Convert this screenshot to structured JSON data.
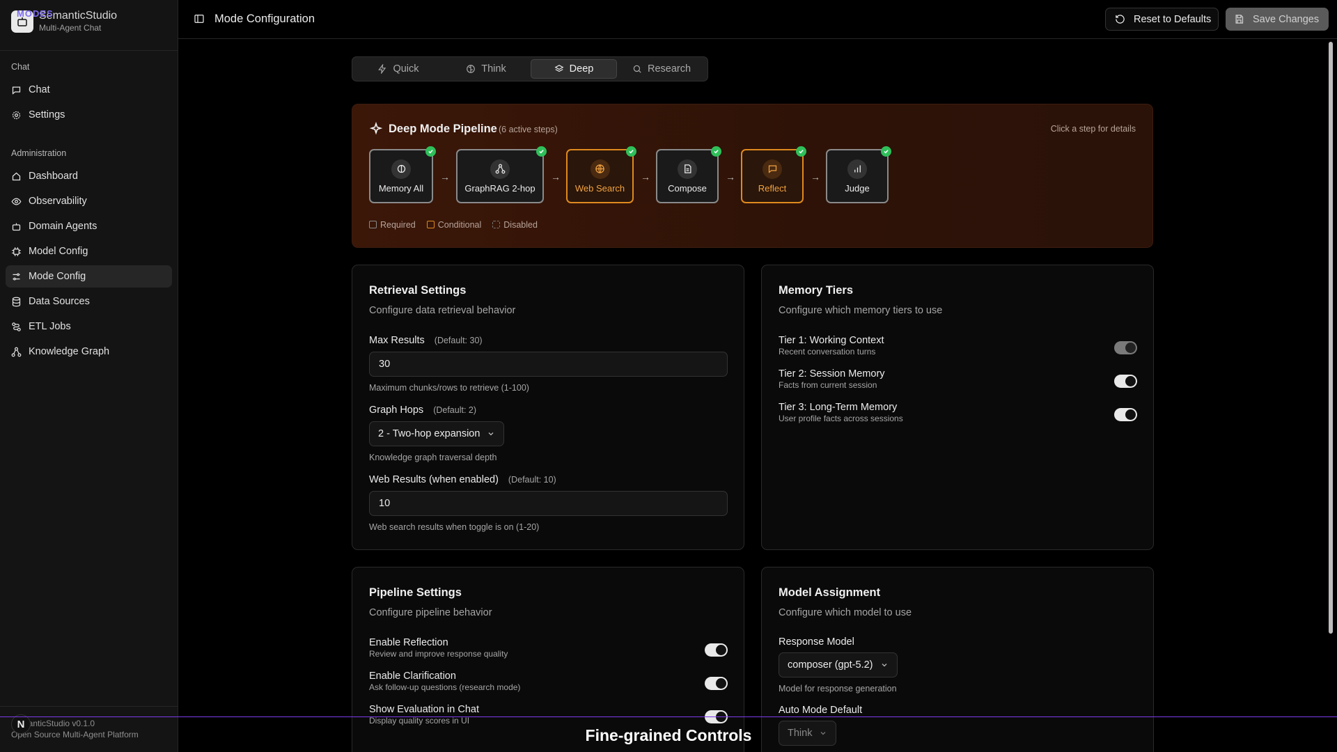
{
  "brand": {
    "tag": "MODES",
    "title": "SemanticStudio",
    "subtitle": "Multi-Agent Chat"
  },
  "sidebar": {
    "groups": [
      {
        "label": "Chat",
        "items": [
          {
            "label": "Chat",
            "icon": "chat-icon"
          },
          {
            "label": "Settings",
            "icon": "gear-icon"
          }
        ]
      },
      {
        "label": "Administration",
        "items": [
          {
            "label": "Dashboard",
            "icon": "home-icon"
          },
          {
            "label": "Observability",
            "icon": "eye-icon"
          },
          {
            "label": "Domain Agents",
            "icon": "bot-icon"
          },
          {
            "label": "Model Config",
            "icon": "chip-icon"
          },
          {
            "label": "Mode Config",
            "icon": "sliders-icon",
            "active": true
          },
          {
            "label": "Data Sources",
            "icon": "database-icon"
          },
          {
            "label": "ETL Jobs",
            "icon": "workflow-icon"
          },
          {
            "label": "Knowledge Graph",
            "icon": "graph-icon"
          }
        ]
      }
    ],
    "footer": {
      "version": "SemanticStudio v0.1.0",
      "platform": "Open Source Multi-Agent Platform",
      "badge": "N"
    }
  },
  "header": {
    "title": "Mode Configuration",
    "reset_label": "Reset to Defaults",
    "save_label": "Save Changes"
  },
  "tabs": [
    {
      "label": "Quick",
      "icon": "zap-icon"
    },
    {
      "label": "Think",
      "icon": "brain-icon"
    },
    {
      "label": "Deep",
      "icon": "layers-icon",
      "active": true
    },
    {
      "label": "Research",
      "icon": "search-icon"
    }
  ],
  "pipeline": {
    "title": "Deep Mode Pipeline",
    "count": "(6 active steps)",
    "hint": "Click a step for details",
    "steps": [
      {
        "label": "Memory All",
        "kind": "required",
        "icon": "brain-icon"
      },
      {
        "label": "GraphRAG 2-hop",
        "kind": "required",
        "icon": "network-icon"
      },
      {
        "label": "Web Search",
        "kind": "conditional",
        "icon": "globe-icon"
      },
      {
        "label": "Compose",
        "kind": "required",
        "icon": "document-icon"
      },
      {
        "label": "Reflect",
        "kind": "conditional",
        "icon": "message-icon"
      },
      {
        "label": "Judge",
        "kind": "required",
        "icon": "bar-chart-icon"
      }
    ],
    "legend": {
      "required": "Required",
      "conditional": "Conditional",
      "disabled": "Disabled"
    },
    "colors": {
      "required": "#8a8a8a",
      "conditional": "#e08a1e",
      "check": "#2fbf5a"
    }
  },
  "retrieval": {
    "title": "Retrieval Settings",
    "desc": "Configure data retrieval behavior",
    "max_results": {
      "label": "Max Results",
      "default": "(Default: 30)",
      "value": "30",
      "help": "Maximum chunks/rows to retrieve (1-100)"
    },
    "graph_hops": {
      "label": "Graph Hops",
      "default": "(Default: 2)",
      "value": "2 - Two-hop expansion",
      "help": "Knowledge graph traversal depth"
    },
    "web_results": {
      "label": "Web Results (when enabled)",
      "default": "(Default: 10)",
      "value": "10",
      "help": "Web search results when toggle is on (1-20)"
    }
  },
  "memory": {
    "title": "Memory Tiers",
    "desc": "Configure which memory tiers to use",
    "tiers": [
      {
        "label": "Tier 1: Working Context",
        "sub": "Recent conversation turns",
        "on": true,
        "disabled": true
      },
      {
        "label": "Tier 2: Session Memory",
        "sub": "Facts from current session",
        "on": true
      },
      {
        "label": "Tier 3: Long-Term Memory",
        "sub": "User profile facts across sessions",
        "on": true
      }
    ]
  },
  "pipeline_settings": {
    "title": "Pipeline Settings",
    "desc": "Configure pipeline behavior",
    "toggles": [
      {
        "label": "Enable Reflection",
        "sub": "Review and improve response quality",
        "on": true
      },
      {
        "label": "Enable Clarification",
        "sub": "Ask follow-up questions (research mode)",
        "on": true
      },
      {
        "label": "Show Evaluation in Chat",
        "sub": "Display quality scores in UI",
        "on": true
      }
    ]
  },
  "model": {
    "title": "Model Assignment",
    "desc": "Configure which model to use",
    "response_label": "Response Model",
    "response_value": "composer (gpt-5.2)",
    "response_help": "Model for response generation",
    "auto_label": "Auto Mode Default",
    "auto_value": "Think"
  },
  "caption": "Fine-grained Controls"
}
